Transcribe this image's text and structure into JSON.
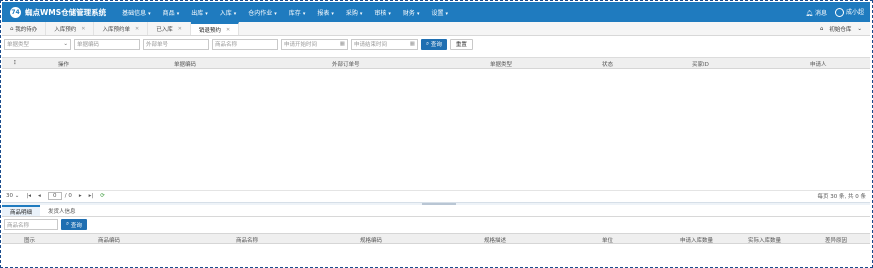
{
  "app": {
    "logo_mark": "74",
    "title": "蜘点WMS仓储管理系统"
  },
  "menu": [
    "基础信息",
    "商品",
    "出库",
    "入库",
    "仓内作业",
    "库存",
    "报表",
    "采购",
    "审核",
    "财务",
    "设置"
  ],
  "user": {
    "message": "消息",
    "name": "成小超"
  },
  "tabs": [
    {
      "label": "我的待办",
      "active": false,
      "closable": false
    },
    {
      "label": "入库预约",
      "active": false,
      "closable": true
    },
    {
      "label": "入库预约单",
      "active": false,
      "closable": true
    },
    {
      "label": "已入库",
      "active": false,
      "closable": true
    },
    {
      "label": "销退预约",
      "active": true,
      "closable": true
    }
  ],
  "warehouse": {
    "label": "初始仓库",
    "chevron": "⌄"
  },
  "search": {
    "doc_type_placeholder": "单据类型",
    "doc_no_placeholder": "单据编码",
    "ext_no_placeholder": "外部单号",
    "product_placeholder": "商品名称",
    "start_placeholder": "申请开始时间",
    "end_placeholder": "申请结束时间",
    "query_label": "查询",
    "reset_label": "重置"
  },
  "grid": {
    "menu_glyph": "⋮",
    "columns": [
      "操作",
      "单据编码",
      "外部订单号",
      "单据类型",
      "状态",
      "买家ID",
      "申请人"
    ]
  },
  "pager": {
    "page_size": "30",
    "current_page": "0",
    "total_pages": "/ 0",
    "summary": "每页 30 条, 共 0 条"
  },
  "bottom": {
    "tabs": [
      "商品明细",
      "发货人信息"
    ],
    "active_tab": "商品明细",
    "search_placeholder": "商品名称",
    "query_label": "查询",
    "columns": [
      "图示",
      "商品编码",
      "商品名称",
      "规格编码",
      "规格描述",
      "单位",
      "申请入库数量",
      "实际入库数量",
      "差异原因"
    ]
  }
}
